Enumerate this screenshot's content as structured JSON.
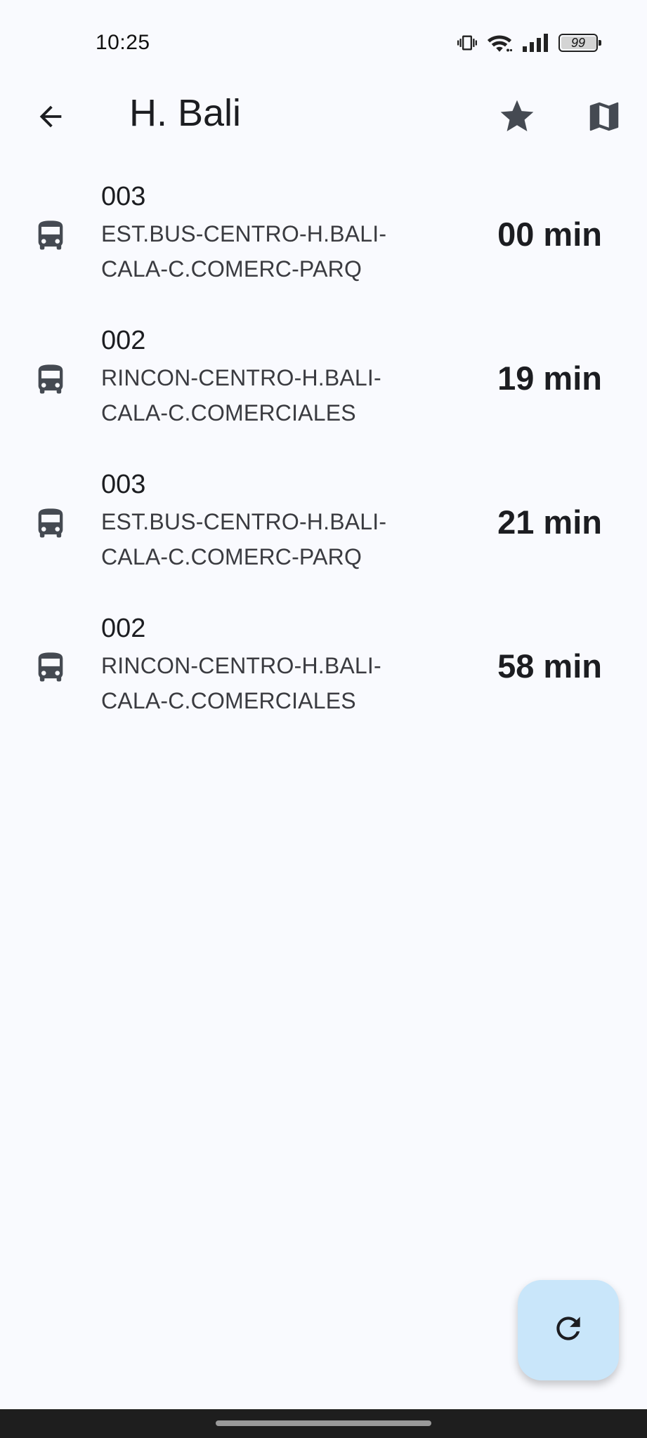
{
  "status_bar": {
    "time": "10:25",
    "battery_level": "99",
    "icons": [
      "vibrate-icon",
      "wifi-icon",
      "signal-icon",
      "battery-icon"
    ]
  },
  "app_bar": {
    "title": "H. Bali",
    "icons": [
      "back-arrow-icon",
      "star-icon",
      "map-icon"
    ]
  },
  "arrivals": [
    {
      "route": "003",
      "line1": "EST.BUS-CENTRO-H.BALI-",
      "line2": "CALA-C.COMERC-PARQ",
      "eta": "00 min"
    },
    {
      "route": "002",
      "line1": "RINCON-CENTRO-H.BALI-",
      "line2": "CALA-C.COMERCIALES",
      "eta": "19 min"
    },
    {
      "route": "003",
      "line1": "EST.BUS-CENTRO-H.BALI-",
      "line2": "CALA-C.COMERC-PARQ",
      "eta": "21 min"
    },
    {
      "route": "002",
      "line1": "RINCON-CENTRO-H.BALI-",
      "line2": "CALA-C.COMERCIALES",
      "eta": "58 min"
    }
  ],
  "fab": {
    "icon": "refresh-icon"
  },
  "colors": {
    "background": "#f9fafe",
    "icon": "#454a52",
    "fab": "#c9e6fa",
    "nav_bar": "#1e1e1e"
  }
}
